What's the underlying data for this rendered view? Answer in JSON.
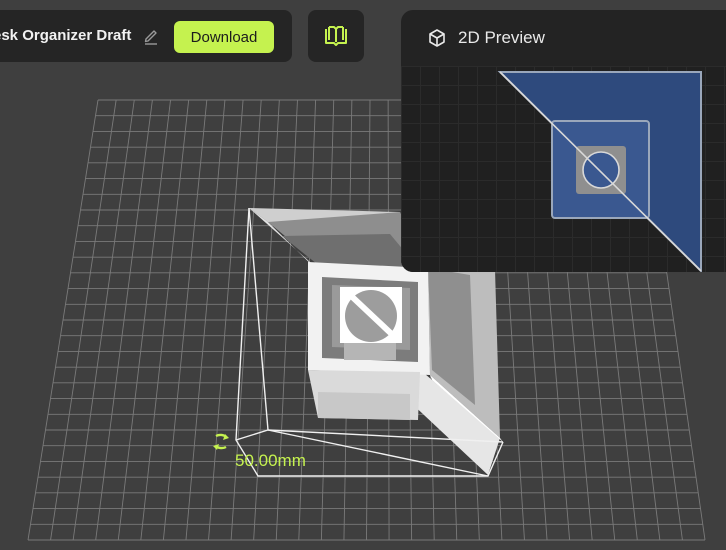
{
  "toolbar": {
    "file_name": "esk Organizer Draft",
    "edit_icon": "pencil-icon",
    "download_label": "Download",
    "library_icon": "book-icon"
  },
  "preview": {
    "icon": "cube-icon",
    "title": "2D Preview"
  },
  "viewport": {
    "dimension_label": "50.00mm",
    "rotate_handle_icon": "rotate-arrows-icon"
  },
  "colors": {
    "accent": "#c5f24f",
    "background": "#3f3f3f",
    "panel": "#252525",
    "preview_fill": "#2e4a7d"
  }
}
